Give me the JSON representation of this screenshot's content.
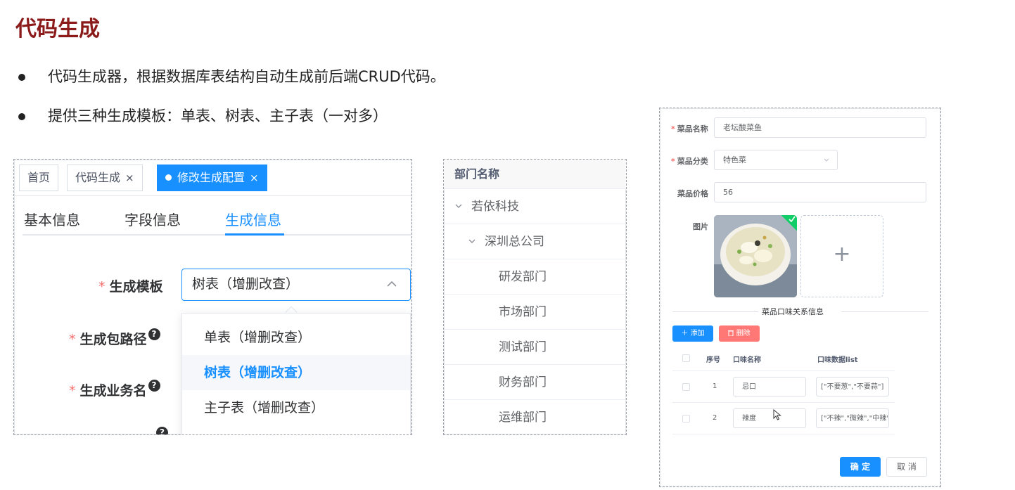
{
  "slide": {
    "title": "代码生成",
    "bullets": [
      "代码生成器，根据数据库表结构自动生成前后端CRUD代码。",
      "提供三种生成模板：单表、树表、主子表（一对多）"
    ]
  },
  "gen_config": {
    "tags": [
      {
        "label": "首页",
        "closable": false,
        "active": false
      },
      {
        "label": "代码生成",
        "closable": true,
        "active": false
      },
      {
        "label": "修改生成配置",
        "closable": true,
        "active": true
      }
    ],
    "close_glyph": "×",
    "tabs": [
      "基本信息",
      "字段信息",
      "生成信息"
    ],
    "active_tab": "生成信息",
    "fields": [
      {
        "label": "生成模板",
        "required": true
      },
      {
        "label": "生成包路径",
        "required": true
      },
      {
        "label": "生成业务名",
        "required": true
      }
    ],
    "required_mark": "*",
    "help_glyph": "?",
    "template_select": {
      "value": "树表（增删改查）",
      "expanded": true
    },
    "template_options": [
      "单表（增删改查）",
      "树表（增删改查）",
      "主子表（增删改查）"
    ],
    "selected_option": "树表（增删改查）"
  },
  "dept_tree": {
    "header": "部门名称",
    "rows": [
      {
        "label": "若依科技",
        "level": 0,
        "expanded": true
      },
      {
        "label": "深圳总公司",
        "level": 1,
        "expanded": true
      },
      {
        "label": "研发部门",
        "level": 2
      },
      {
        "label": "市场部门",
        "level": 2
      },
      {
        "label": "测试部门",
        "level": 2
      },
      {
        "label": "财务部门",
        "level": 2
      },
      {
        "label": "运维部门",
        "level": 2
      }
    ]
  },
  "dish_form": {
    "name_label": "菜品名称",
    "name_value": "老坛酸菜鱼",
    "category_label": "菜品分类",
    "category_value": "特色菜",
    "price_label": "菜品价格",
    "price_value": "56",
    "image_label": "图片",
    "plus_glyph": "+",
    "required_mark": "*",
    "section_title": "菜品口味关系信息",
    "add_button": "＋ 添加",
    "delete_button": "删除",
    "columns": [
      "序号",
      "口味名称",
      "口味数据list"
    ],
    "rows": [
      {
        "index": "1",
        "flavor": "忌口",
        "data": "[\"不要葱\",\"不要蒜\"]"
      },
      {
        "index": "2",
        "flavor": "辣度",
        "data": "[\"不辣\",\"微辣\",\"中辣\"]"
      }
    ],
    "confirm_button": "确 定",
    "cancel_button": "取 消"
  },
  "colors": {
    "title": "#8b1a1a",
    "primary": "#1890ff",
    "danger": "#ff7875",
    "required": "#f56c6c",
    "success": "#13ce66"
  }
}
